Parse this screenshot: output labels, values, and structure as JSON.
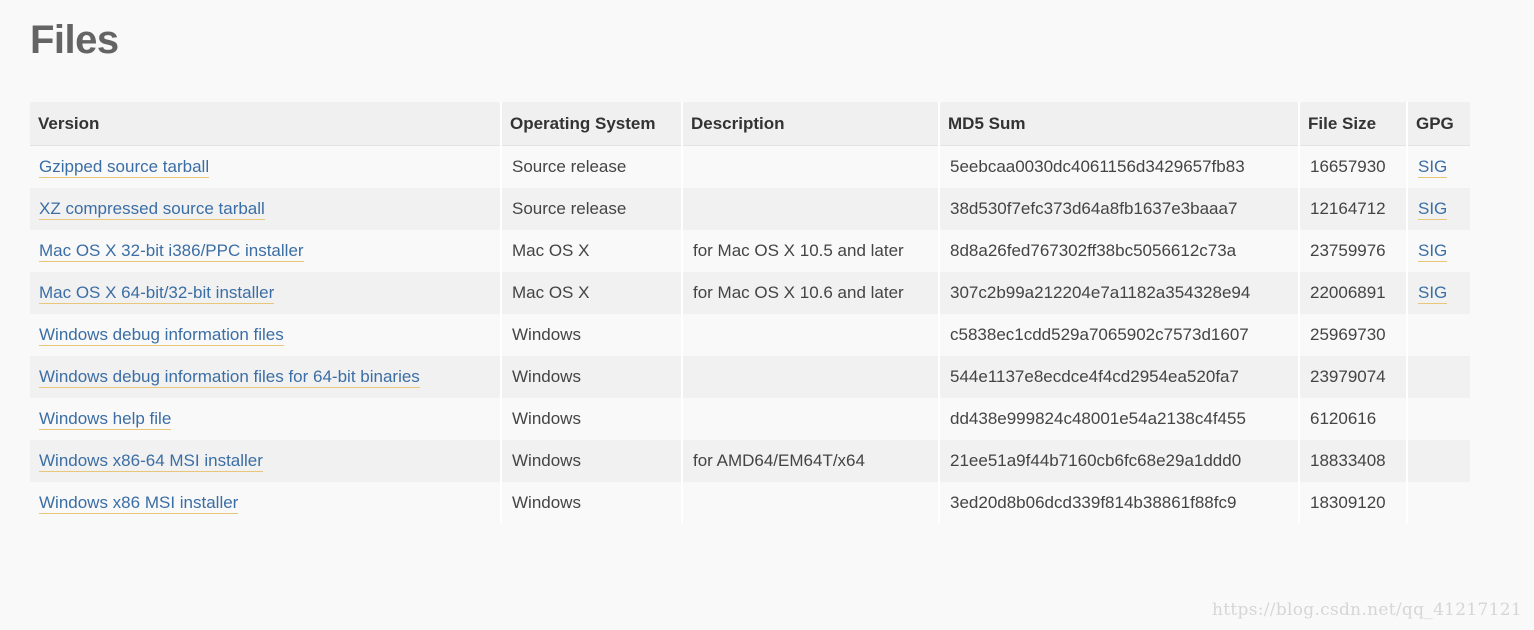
{
  "page": {
    "title": "Files"
  },
  "table": {
    "headers": {
      "version": "Version",
      "os": "Operating System",
      "description": "Description",
      "md5": "MD5 Sum",
      "size": "File Size",
      "gpg": "GPG"
    },
    "rows": [
      {
        "version": "Gzipped source tarball",
        "os": "Source release",
        "description": "",
        "md5": "5eebcaa0030dc4061156d3429657fb83",
        "size": "16657930",
        "gpg": "SIG"
      },
      {
        "version": "XZ compressed source tarball",
        "os": "Source release",
        "description": "",
        "md5": "38d530f7efc373d64a8fb1637e3baaa7",
        "size": "12164712",
        "gpg": "SIG"
      },
      {
        "version": "Mac OS X 32-bit i386/PPC installer",
        "os": "Mac OS X",
        "description": "for Mac OS X 10.5 and later",
        "md5": "8d8a26fed767302ff38bc5056612c73a",
        "size": "23759976",
        "gpg": "SIG"
      },
      {
        "version": "Mac OS X 64-bit/32-bit installer",
        "os": "Mac OS X",
        "description": "for Mac OS X 10.6 and later",
        "md5": "307c2b99a212204e7a1182a354328e94",
        "size": "22006891",
        "gpg": "SIG"
      },
      {
        "version": "Windows debug information files",
        "os": "Windows",
        "description": "",
        "md5": "c5838ec1cdd529a7065902c7573d1607",
        "size": "25969730",
        "gpg": ""
      },
      {
        "version": "Windows debug information files for 64-bit binaries",
        "os": "Windows",
        "description": "",
        "md5": "544e1137e8ecdce4f4cd2954ea520fa7",
        "size": "23979074",
        "gpg": ""
      },
      {
        "version": "Windows help file",
        "os": "Windows",
        "description": "",
        "md5": "dd438e999824c48001e54a2138c4f455",
        "size": "6120616",
        "gpg": ""
      },
      {
        "version": "Windows x86-64 MSI installer",
        "os": "Windows",
        "description": "for AMD64/EM64T/x64",
        "md5": "21ee51a9f44b7160cb6fc68e29a1ddd0",
        "size": "18833408",
        "gpg": ""
      },
      {
        "version": "Windows x86 MSI installer",
        "os": "Windows",
        "description": "",
        "md5": "3ed20d8b06dcd339f814b38861f88fc9",
        "size": "18309120",
        "gpg": ""
      }
    ]
  },
  "watermark": "https://blog.csdn.net/qq_41217121",
  "colors": {
    "link": "#3b6ea5",
    "link_underline": "#e8c77a",
    "title": "#646464",
    "header_bg": "#f0f0f0",
    "row_alt_bg": "#f1f1f1",
    "page_bg": "#f9f9f9"
  }
}
